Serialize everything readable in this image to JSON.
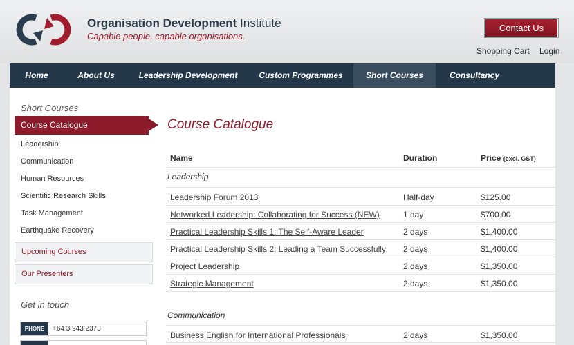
{
  "brand": {
    "name_bold": "Organisation Development",
    "name_rest": " Institute",
    "tagline": "Capable people, capable organisations."
  },
  "header": {
    "contact_label": "Contact Us",
    "shopping_cart": "Shopping Cart",
    "login": "Login"
  },
  "nav": [
    {
      "label": "Home",
      "active": false
    },
    {
      "label": "About Us",
      "active": false
    },
    {
      "label": "Leadership Development",
      "active": false
    },
    {
      "label": "Custom Programmes",
      "active": false
    },
    {
      "label": "Short Courses",
      "active": true
    },
    {
      "label": "Consultancy",
      "active": false
    }
  ],
  "sidebar": {
    "heading": "Short Courses",
    "active_item": "Course Catalogue",
    "items": [
      "Leadership",
      "Communication",
      "Human Resources",
      "Scientific Research Skills",
      "Task Management",
      "Earthquake Recovery"
    ],
    "boxes": [
      "Upcoming Courses",
      "Our Presenters"
    ],
    "contact_heading": "Get in touch",
    "contact": [
      {
        "label": "PHONE",
        "value": "+64 3 943 2373"
      }
    ]
  },
  "main": {
    "title": "Course Catalogue",
    "columns": {
      "name": "Name",
      "duration": "Duration",
      "price": "Price",
      "price_note": "(excl. GST)"
    },
    "groups": [
      {
        "title": "Leadership",
        "rows": [
          {
            "name": "Leadership Forum 2013",
            "duration": "Half-day",
            "price": "$125.00"
          },
          {
            "name": "Networked Leadership: Collaborating for Success (NEW)",
            "duration": "1 day",
            "price": "$700.00"
          },
          {
            "name": "Practical Leadership Skills 1: The Self-Aware Leader",
            "duration": "2 days",
            "price": "$1,400.00"
          },
          {
            "name": "Practical Leadership Skills 2: Leading a Team Successfully",
            "duration": "2 days",
            "price": "$1,400.00"
          },
          {
            "name": "Project Leadership",
            "duration": "2 days",
            "price": "$1,350.00"
          },
          {
            "name": "Strategic Management",
            "duration": "2 days",
            "price": "$1,350.00"
          }
        ]
      },
      {
        "title": "Communication",
        "rows": [
          {
            "name": "Business English for International Professionals",
            "duration": "2 days",
            "price": "$1,350.00"
          }
        ]
      }
    ]
  },
  "colors": {
    "brand_red": "#8c1b2b",
    "nav_navy": "#24384a"
  }
}
